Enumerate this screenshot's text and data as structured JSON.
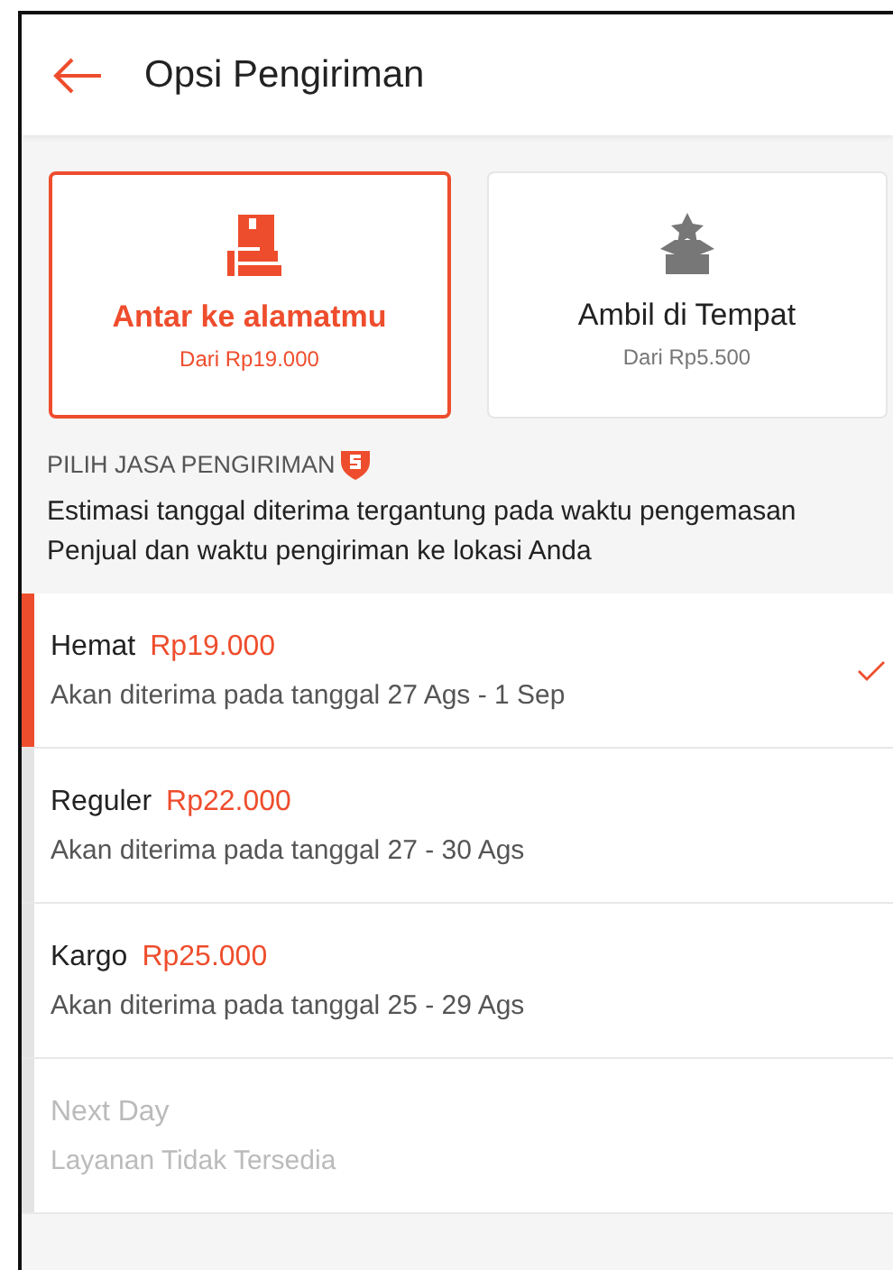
{
  "header": {
    "title": "Opsi Pengiriman"
  },
  "delivery_methods": [
    {
      "kind": "delivery",
      "label": "Antar ke alamatmu",
      "price": "Dari Rp19.000",
      "selected": true
    },
    {
      "kind": "pickup",
      "label": "Ambil di Tempat",
      "price": "Dari Rp5.500",
      "selected": false
    }
  ],
  "section": {
    "heading": "PILIH JASA PENGIRIMAN",
    "note": "Estimasi tanggal diterima tergantung pada waktu pengemasan Penjual dan waktu pengiriman ke lokasi Anda"
  },
  "services": [
    {
      "name": "Hemat",
      "price": "Rp19.000",
      "eta": "Akan diterima pada tanggal 27 Ags - 1 Sep",
      "selected": true,
      "disabled": false
    },
    {
      "name": "Reguler",
      "price": "Rp22.000",
      "eta": "Akan diterima pada tanggal 27 - 30 Ags",
      "selected": false,
      "disabled": false
    },
    {
      "name": "Kargo",
      "price": "Rp25.000",
      "eta": "Akan diterima pada tanggal 25 - 29 Ags",
      "selected": false,
      "disabled": false
    },
    {
      "name": "Next Day",
      "eta": "Layanan Tidak Tersedia",
      "selected": false,
      "disabled": true
    }
  ]
}
